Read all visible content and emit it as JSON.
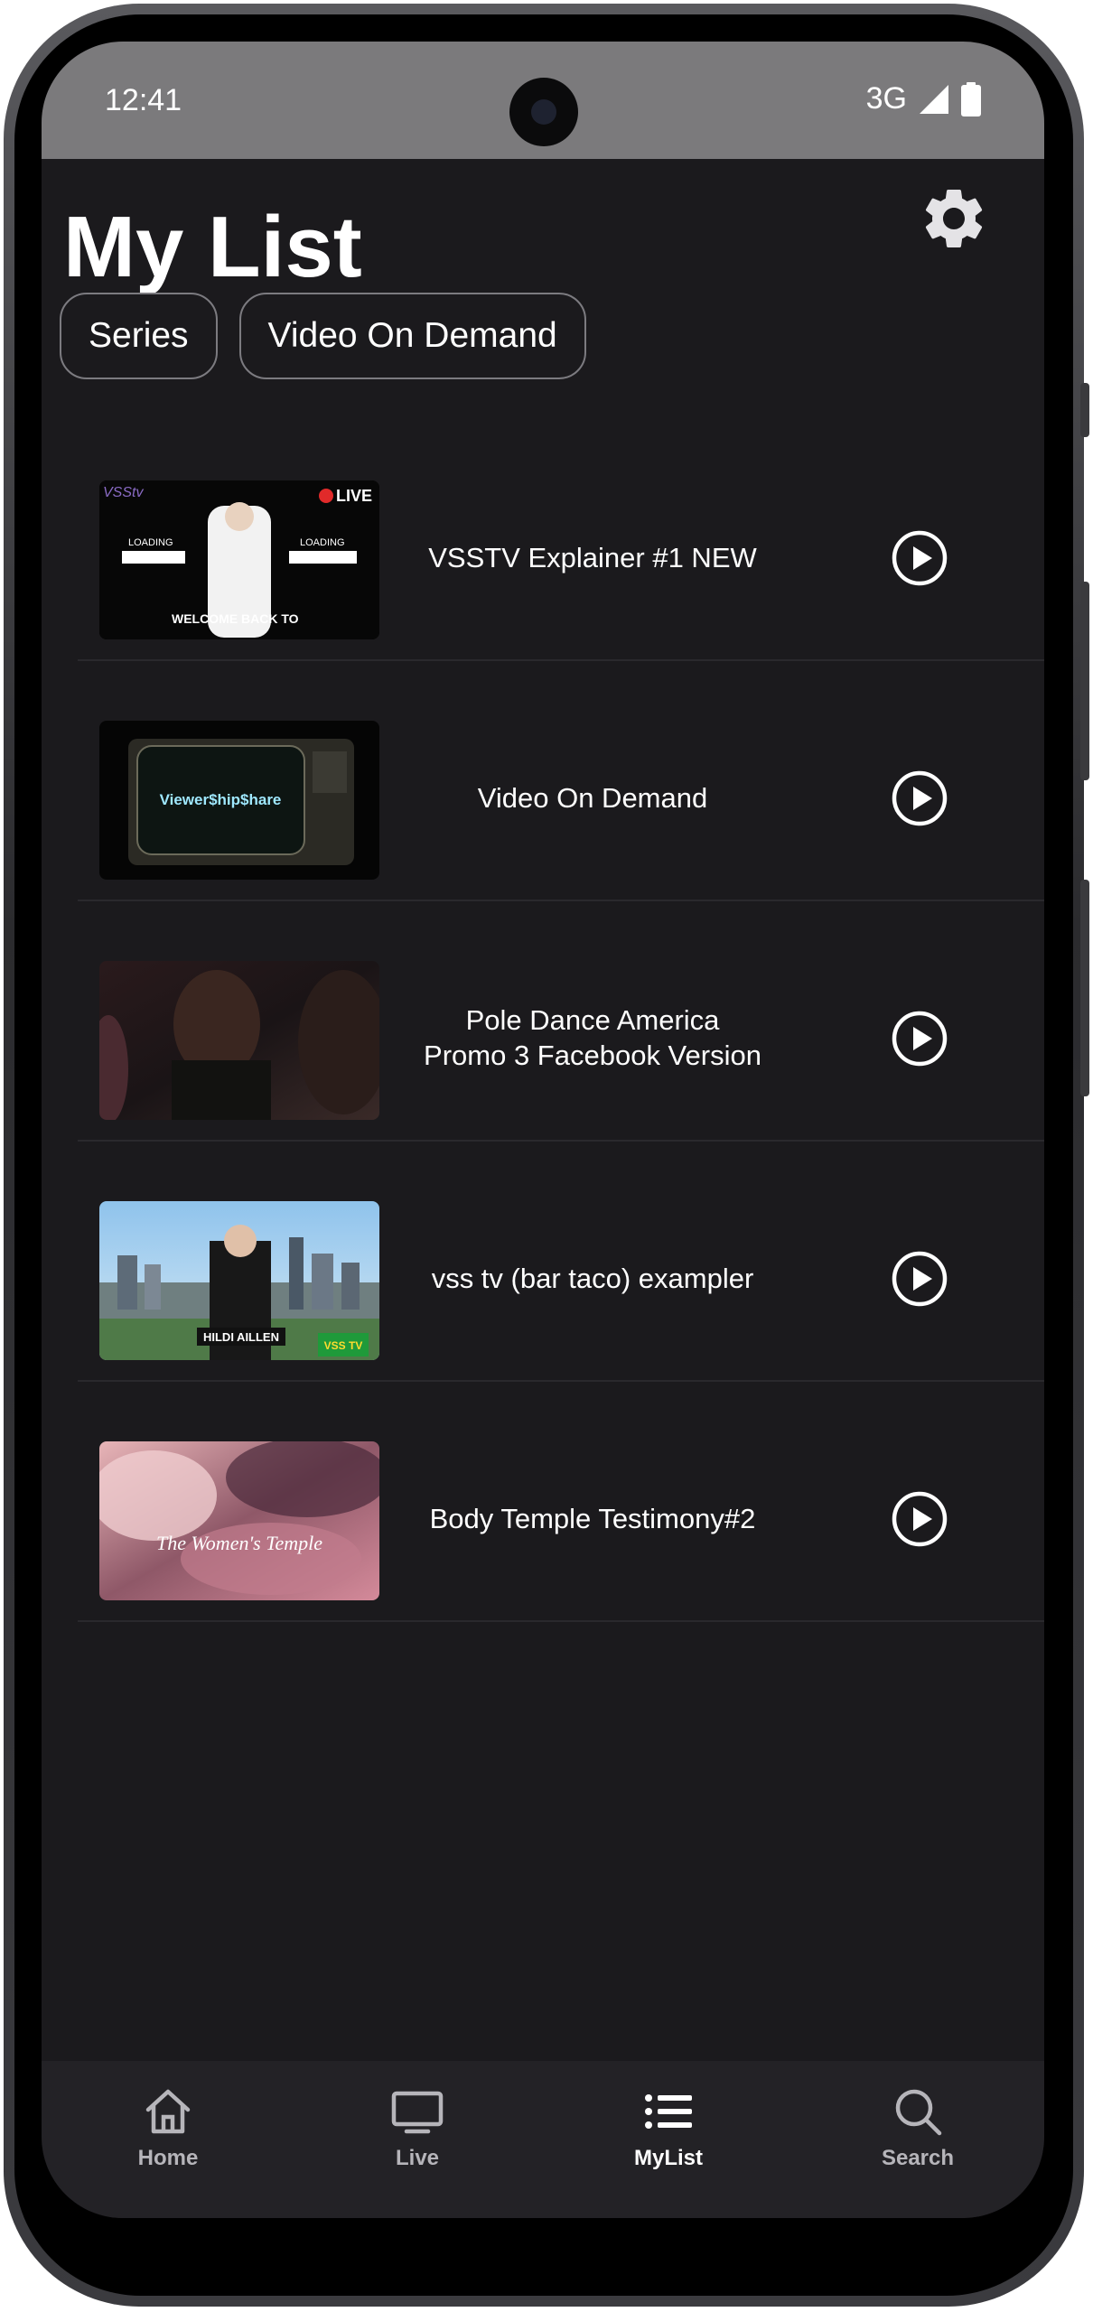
{
  "status": {
    "time": "12:41",
    "network": "3G"
  },
  "header": {
    "title": "My List"
  },
  "filters": [
    {
      "label": "Series"
    },
    {
      "label": "Video On Demand"
    }
  ],
  "list": [
    {
      "title": "VSSTV Explainer #1 NEW",
      "thumb_text": "WELCOME BACK TO",
      "thumb_badge": "LIVE",
      "thumb_brand": "VSStv",
      "thumb_loading": "LOADING"
    },
    {
      "title": "Video On Demand",
      "thumb_text": "Viewer$hip$hare"
    },
    {
      "title": "Pole Dance America Promo 3 Facebook Version"
    },
    {
      "title": "vss tv (bar taco) exampler",
      "thumb_text": "HILDI AILLEN",
      "thumb_badge": "VSS TV"
    },
    {
      "title": "Body Temple Testimony#2",
      "thumb_text": "The Women's Temple"
    }
  ],
  "nav": [
    {
      "label": "Home",
      "icon": "home-icon"
    },
    {
      "label": "Live",
      "icon": "tv-icon"
    },
    {
      "label": "MyList",
      "icon": "list-icon",
      "active": true
    },
    {
      "label": "Search",
      "icon": "search-icon"
    }
  ],
  "colors": {
    "background": "#1b1a1d",
    "status_bar": "#7b7a7c",
    "nav_bar": "#232226",
    "text": "#ffffff",
    "chip_border": "#7c7b80"
  }
}
